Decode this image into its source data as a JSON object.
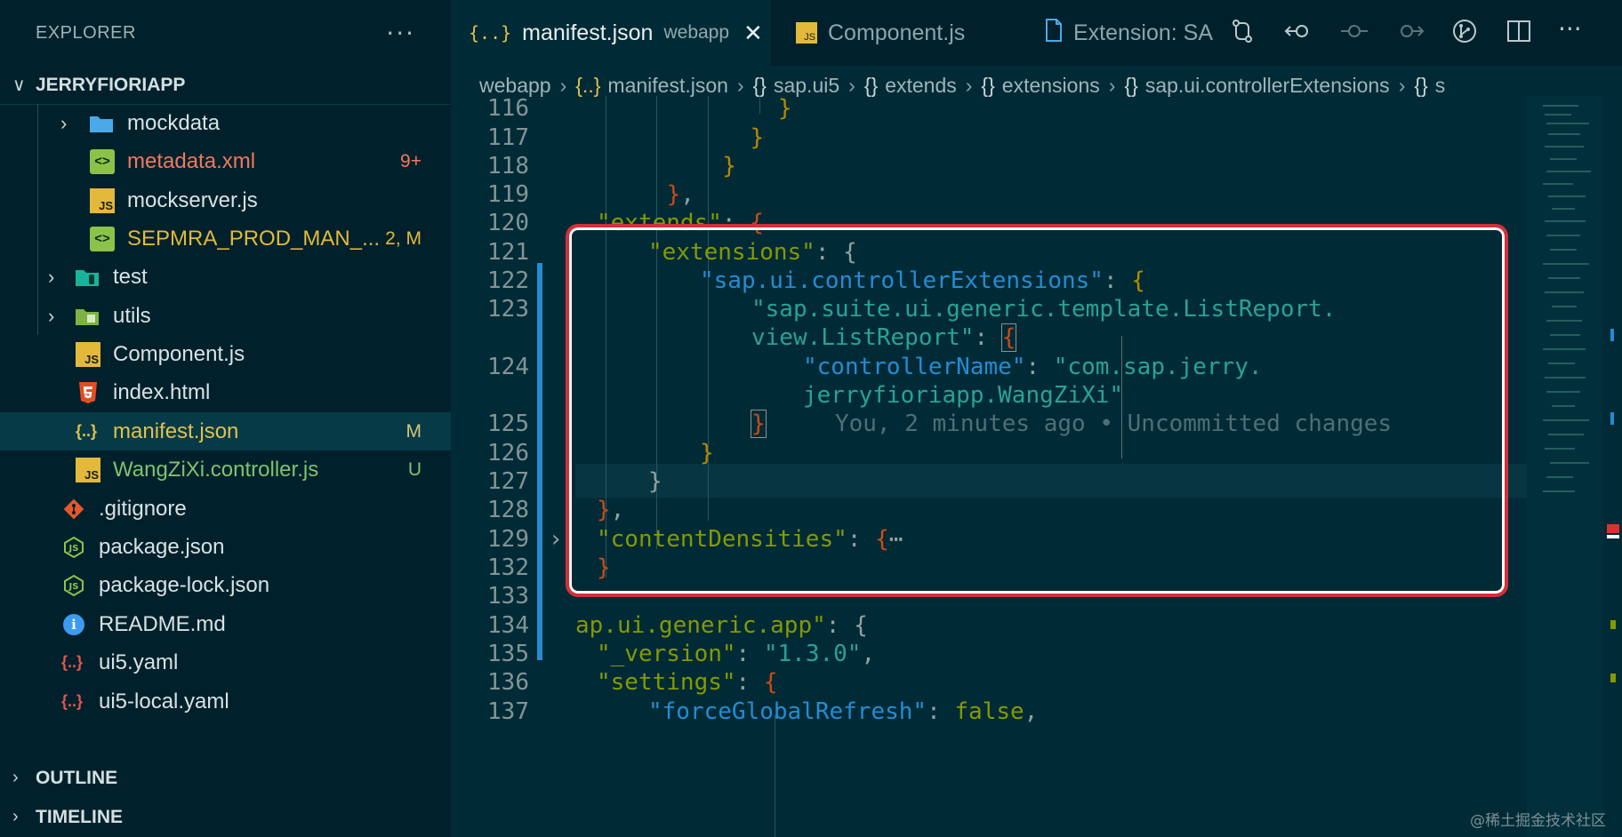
{
  "sidebar": {
    "title": "EXPLORER",
    "more_label": "···",
    "project": "JERRYFIORIAPP",
    "items": [
      {
        "label": "mockdata",
        "icon": "folder-icon",
        "badge": "",
        "color": "#d8e2e4"
      },
      {
        "label": "metadata.xml",
        "icon": "xml-icon",
        "badge": "9+",
        "color": "#f07860",
        "badge_color": "#f07860"
      },
      {
        "label": "mockserver.js",
        "icon": "js-icon",
        "badge": "",
        "color": "#d8e2e4"
      },
      {
        "label": "SEPMRA_PROD_MAN_...",
        "icon": "xml-icon",
        "badge": "2, M",
        "color": "#e2b93b",
        "badge_color": "#e2b93b"
      },
      {
        "label": "test",
        "icon": "test-folder-icon",
        "badge": "",
        "color": "#d8e2e4"
      },
      {
        "label": "utils",
        "icon": "utils-folder-icon",
        "badge": "",
        "color": "#d8e2e4"
      },
      {
        "label": "Component.js",
        "icon": "js-icon",
        "badge": "",
        "color": "#d8e2e4"
      },
      {
        "label": "index.html",
        "icon": "html-icon",
        "badge": "",
        "color": "#d8e2e4"
      },
      {
        "label": "manifest.json",
        "icon": "json-icon",
        "badge": "M",
        "color": "#e2c04f",
        "badge_color": "#d8c37a"
      },
      {
        "label": "WangZiXi.controller.js",
        "icon": "js-icon",
        "badge": "U",
        "color": "#7fc36d",
        "badge_color": "#7fc36d"
      },
      {
        "label": ".gitignore",
        "icon": "git-icon",
        "badge": "",
        "color": "#d8e2e4"
      },
      {
        "label": "package.json",
        "icon": "npm-icon",
        "badge": "",
        "color": "#d8e2e4"
      },
      {
        "label": "package-lock.json",
        "icon": "npm-icon",
        "badge": "",
        "color": "#d8e2e4"
      },
      {
        "label": "README.md",
        "icon": "info-icon",
        "badge": "",
        "color": "#d8e2e4"
      },
      {
        "label": "ui5.yaml",
        "icon": "yaml-icon",
        "badge": "",
        "color": "#d8e2e4"
      },
      {
        "label": "ui5-local.yaml",
        "icon": "yaml-icon",
        "badge": "",
        "color": "#d8e2e4"
      }
    ],
    "outline_label": "OUTLINE",
    "timeline_label": "TIMELINE"
  },
  "tabs": [
    {
      "label": "manifest.json",
      "description": "webapp",
      "icon": "json-icon",
      "active": true
    },
    {
      "label": "Component.js",
      "icon": "js-icon",
      "active": false
    },
    {
      "label": "Extension: SA",
      "icon": "file-icon",
      "active": false
    }
  ],
  "breadcrumb": [
    "webapp",
    "manifest.json",
    "sap.ui5",
    "extends",
    "extensions",
    "sap.ui.controllerExtensions",
    "s"
  ],
  "code": {
    "line_numbers": [
      "116",
      "117",
      "118",
      "119",
      "120",
      "121",
      "122",
      "123",
      "",
      "124",
      "",
      "125",
      "126",
      "127",
      "128",
      "129",
      "132",
      "133",
      "134",
      "135",
      "136",
      "137"
    ],
    "lines": [
      "            }",
      "          }",
      "        }",
      "    },",
      "    \"extends\": {",
      "        \"extensions\": {",
      "            \"sap.ui.controllerExtensions\": {",
      "                \"sap.suite.ui.generic.template.ListReport.",
      "                view.ListReport\": {",
      "                    \"controllerName\": \"com.sap.jerry.",
      "                    jerryfioriapp.WangZiXi\"",
      "                }",
      "            }",
      "        }",
      "    },",
      "    \"contentDensities\": {⋯",
      "    }",
      "",
      "  ap.ui.generic.app\": {",
      "    \"_version\": \"1.3.0\",",
      "    \"settings\": {",
      "        \"forceGlobalRefresh\": false,"
    ],
    "blame": "You, 2 minutes ago • Uncommitted changes"
  },
  "watermark": "@稀土掘金技术社区"
}
